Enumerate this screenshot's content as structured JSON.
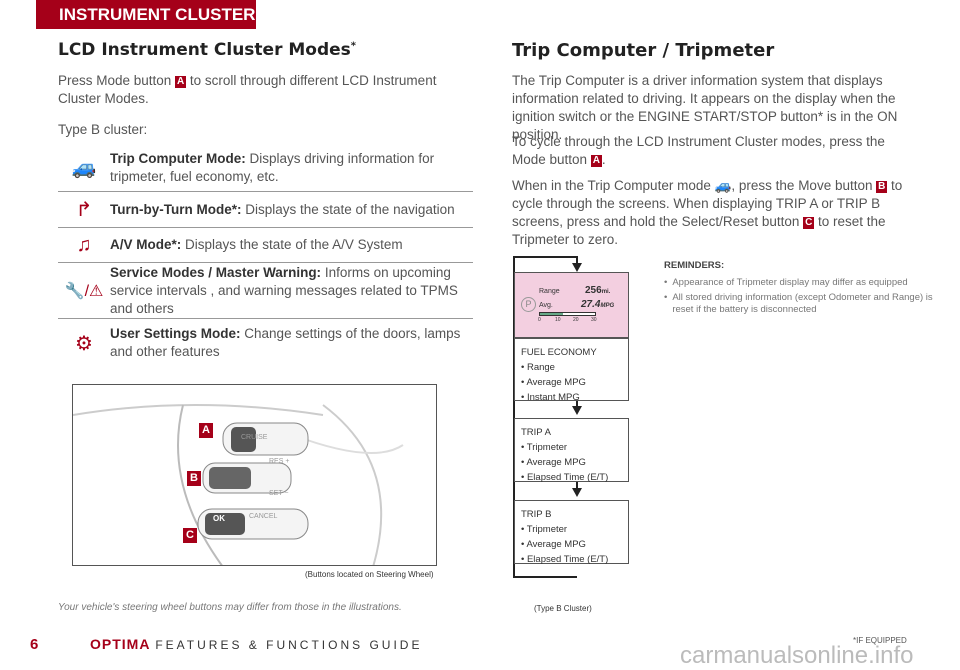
{
  "header": {
    "section": "INSTRUMENT CLUSTER"
  },
  "left": {
    "title": "LCD Instrument Cluster Modes",
    "title_mark": "*",
    "intro_pre": "Press Mode button ",
    "intro_badge": "A",
    "intro_post": " to scroll through different LCD Instrument Cluster Modes.",
    "type": "Type B cluster:",
    "modes": [
      {
        "icon": "car-trip-icon",
        "name": "Trip Computer Mode:",
        "desc": " Displays driving information for tripmeter, fuel economy, etc."
      },
      {
        "icon": "turn-arrow-icon",
        "name": "Turn-by-Turn Mode*:",
        "desc": " Displays the state of the navigation"
      },
      {
        "icon": "music-note-icon",
        "name": "A/V Mode*:",
        "desc": " Displays the state of the A/V System"
      },
      {
        "icon": "wrench-warning-icon",
        "name": "Service Modes / Master Warning:",
        "desc": " Informs on upcoming service intervals , and warning messages related to TPMS and others"
      },
      {
        "icon": "gear-icon",
        "name": "User Settings Mode:",
        "desc": " Change settings of the doors, lamps and other features"
      }
    ],
    "wheel": {
      "cruise": "CRUISE",
      "res": "RES +",
      "set": "SET −",
      "ok": "OK",
      "cancel": "CANCEL",
      "labels": [
        "A",
        "B",
        "C"
      ],
      "caption": "(Buttons located on Steering Wheel)"
    },
    "disclaimer": "Your vehicle's steering wheel buttons may differ from those in the illustrations."
  },
  "right": {
    "title": "Trip Computer / Tripmeter",
    "p1": "The Trip Computer is a driver information system that displays information related to driving. It appears on the display when the ignition switch or the ENGINE START/STOP button* is in the ON position.",
    "p2_pre": "To cycle through the LCD Instrument Cluster modes, press the Mode button ",
    "p2_badge": "A",
    "p2_post": ".",
    "p3_a": "When in the Trip Computer mode ",
    "p3_b": ", press the Move button ",
    "p3_badge_b": "B",
    "p3_c": " to cycle through the screens. When displaying TRIP A or TRIP B screens, press and hold the Select/Reset button ",
    "p3_badge_c": "C",
    "p3_d": " to reset the Tripmeter to zero.",
    "display": {
      "gear": "P",
      "range_label": "Range",
      "range_value": "256",
      "range_unit": "mi.",
      "avg_label": "Avg.",
      "avg_value": "27.4",
      "avg_unit": "MPG",
      "scale": [
        "0",
        "10",
        "20",
        "30"
      ],
      "color": "#f3cfe0"
    },
    "boxes": [
      {
        "title": "FUEL ECONOMY",
        "items": [
          "• Range",
          "• Average MPG",
          "• Instant MPG"
        ]
      },
      {
        "title": "TRIP A",
        "items": [
          "• Tripmeter",
          "• Average MPG",
          "• Elapsed Time (E/T)"
        ]
      },
      {
        "title": "TRIP B",
        "items": [
          "• Tripmeter",
          "• Average MPG",
          "• Elapsed Time (E/T)"
        ]
      }
    ],
    "reminders_title": "REMINDERS:",
    "reminders": [
      "Appearance of Tripmeter display may differ as equipped",
      "All stored driving information (except Odometer and Range) is reset if the battery is disconnected"
    ],
    "caption": "(Type B Cluster)"
  },
  "footer": {
    "page": "6",
    "brand": "OPTIMA",
    "guide": "FEATURES & FUNCTIONS GUIDE",
    "note": "*IF EQUIPPED",
    "watermark": "carmanualsonline.info"
  },
  "colors": {
    "accent": "#a50019"
  }
}
